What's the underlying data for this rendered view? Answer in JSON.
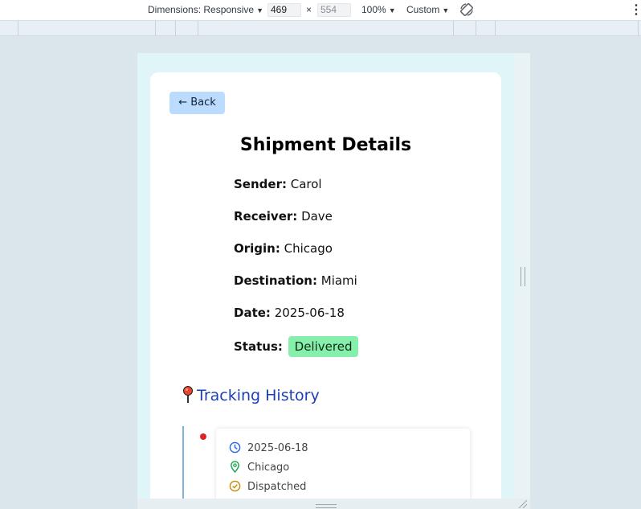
{
  "devtools": {
    "dimensions_label": "Dimensions: Responsive",
    "width": "469",
    "height": "554",
    "times": "×",
    "zoom": "100%",
    "throttle": "Custom",
    "more": "⋮"
  },
  "page": {
    "back_label": "← Back",
    "title": "Shipment Details",
    "fields": {
      "sender": {
        "label": "Sender:",
        "value": "Carol"
      },
      "receiver": {
        "label": "Receiver:",
        "value": "Dave"
      },
      "origin": {
        "label": "Origin:",
        "value": "Chicago"
      },
      "destination": {
        "label": "Destination:",
        "value": "Miami"
      },
      "date": {
        "label": "Date:",
        "value": "2025-06-18"
      },
      "status": {
        "label": "Status:",
        "value": "Delivered"
      }
    },
    "tracking": {
      "title": "Tracking History",
      "events": [
        {
          "date": "2025-06-18",
          "location": "Chicago",
          "status": "Dispatched"
        }
      ]
    }
  },
  "colors": {
    "status_badge": "#86efac",
    "accent_title": "#1e40af",
    "event_dot": "#e02424"
  }
}
